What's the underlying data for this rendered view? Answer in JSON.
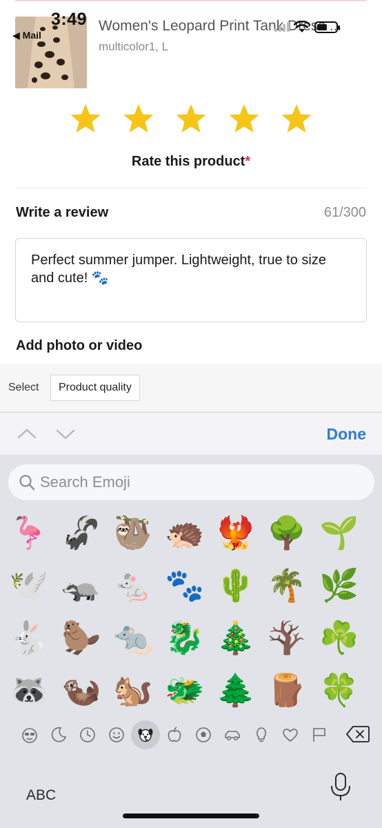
{
  "status_bar": {
    "time": "3:49",
    "back_label": "◀ Mail"
  },
  "product": {
    "title": "Women's Leopard Print Tank Dress ...",
    "variant": "multicolor1, L"
  },
  "rating": {
    "stars_filled": 5,
    "stars_total": 5,
    "label": "Rate this product",
    "required_mark": "*",
    "star_color": "#f5c518"
  },
  "review": {
    "label": "Write a review",
    "count": "61/300",
    "text": "Perfect summer jumper. Lightweight, true to size and cute! 🐾"
  },
  "add_media_label": "Add photo or video",
  "select_bar": {
    "label": "Select",
    "chip": "Product quality"
  },
  "accessory": {
    "done_label": "Done",
    "done_color": "#2f7ad8"
  },
  "keyboard": {
    "search_placeholder": "Search Emoji",
    "emoji_rows": [
      [
        "🦩",
        "🦨",
        "🦥",
        "🦔",
        "🐦‍🔥",
        "🌳",
        "🌱"
      ],
      [
        "🕊️",
        "🦡",
        "🐁",
        "🐾",
        "🌵",
        "🌴",
        "🌿"
      ],
      [
        "🐇",
        "🦫",
        "🐀",
        "🐉",
        "🎄",
        "🪾",
        "☘️"
      ],
      [
        "🦝",
        "🦦",
        "🐿️",
        "🐲",
        "🌲",
        "🪵",
        "🍀"
      ]
    ],
    "categories": [
      "smileys-people",
      "moon",
      "recents",
      "smiley",
      "animals-nature",
      "food",
      "activity",
      "travel",
      "objects",
      "symbols",
      "flags"
    ],
    "active_category": "animals-nature",
    "abc_label": "ABC"
  }
}
